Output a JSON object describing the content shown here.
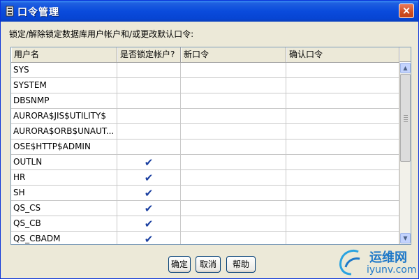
{
  "window": {
    "title": "口令管理",
    "close_label": "×"
  },
  "instructions": "锁定/解除锁定数据库用户帐户和/或更改默认口令:",
  "table": {
    "columns": [
      "用户名",
      "是否锁定帐户?",
      "新口令",
      "确认口令"
    ],
    "rows": [
      {
        "user": "SYS",
        "locked": false
      },
      {
        "user": "SYSTEM",
        "locked": false
      },
      {
        "user": "DBSNMP",
        "locked": false
      },
      {
        "user": "AURORA$JIS$UTILITY$",
        "locked": false
      },
      {
        "user": "AURORA$ORB$UNAUT...",
        "locked": false
      },
      {
        "user": "OSE$HTTP$ADMIN",
        "locked": false
      },
      {
        "user": "OUTLN",
        "locked": true
      },
      {
        "user": "HR",
        "locked": true
      },
      {
        "user": "SH",
        "locked": true
      },
      {
        "user": "QS_CS",
        "locked": true
      },
      {
        "user": "QS_CB",
        "locked": true
      },
      {
        "user": "QS_CBADM",
        "locked": true
      }
    ],
    "check_glyph": "✔"
  },
  "buttons": {
    "ok": "确定",
    "cancel": "取消",
    "help": "帮助"
  },
  "watermark": {
    "cn": "运维网",
    "url": "iyunv.com"
  },
  "colors": {
    "titlebar": "#0a4bdc",
    "dialog_bg": "#ece9d8",
    "check": "#1a3fa0",
    "close": "#d04d21"
  }
}
